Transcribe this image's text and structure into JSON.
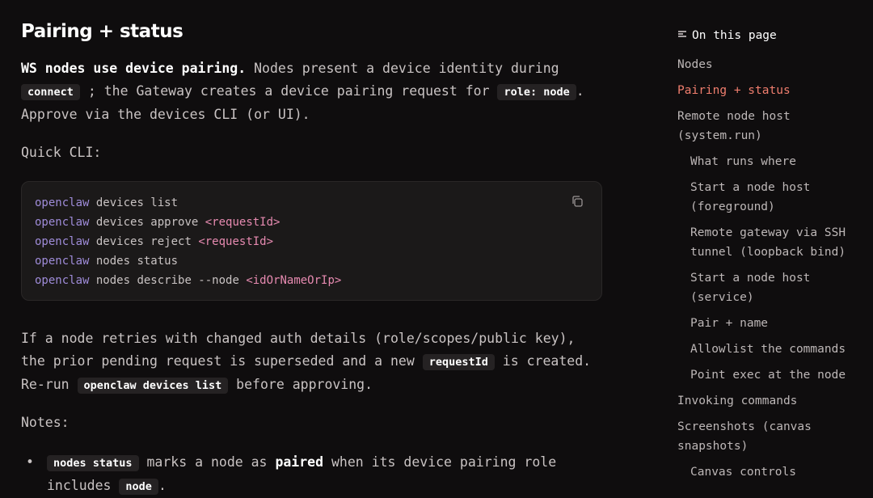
{
  "heading": "Pairing + status",
  "para1": {
    "bold": "WS nodes use device pairing.",
    "t1": " Nodes present a device identity during",
    "code1": "connect",
    "t2": "; the Gateway creates a device pairing request for",
    "code2": "role: node",
    "t3": ".",
    "t4": "Approve via the devices CLI (or UI)."
  },
  "quick_cli": "Quick CLI:",
  "code_block": {
    "lines": [
      {
        "cmd": "openclaw",
        "args": "devices list",
        "ph": ""
      },
      {
        "cmd": "openclaw",
        "args": "devices approve",
        "ph": "<requestId>"
      },
      {
        "cmd": "openclaw",
        "args": "devices reject",
        "ph": "<requestId>"
      },
      {
        "cmd": "openclaw",
        "args": "nodes status",
        "ph": ""
      },
      {
        "cmd": "openclaw",
        "args": "nodes describe --node",
        "ph": "<idOrNameOrIp>"
      }
    ],
    "copy_icon": "copy-icon"
  },
  "para2": {
    "l1": "If a node retries with changed auth details (role/scopes/public key),",
    "l2a": "the prior pending request is superseded and a new",
    "code1": "requestId",
    "l2b": "is created.",
    "l3a": "Re-run",
    "code2": "openclaw devices list",
    "l3b": "before approving."
  },
  "notes_label": "Notes:",
  "notes": {
    "item1": {
      "code": "nodes status",
      "t1": "marks a node as",
      "bold": "paired",
      "t2": "when its device pairing role",
      "t3": "includes",
      "code2": "node",
      "t4": "."
    }
  },
  "toc": {
    "title": "On this page",
    "icon": "list-icon",
    "items": [
      {
        "label": "Nodes"
      },
      {
        "label": "Pairing + status"
      },
      {
        "label": "Remote node host"
      },
      {
        "label": "(system.run)"
      },
      {
        "label": "What runs where"
      },
      {
        "label": "Start a node host"
      },
      {
        "label": "(foreground)"
      },
      {
        "label": "Remote gateway via SSH"
      },
      {
        "label": "tunnel (loopback bind)"
      },
      {
        "label": "Start a node host"
      },
      {
        "label": "(service)"
      },
      {
        "label": "Pair + name"
      },
      {
        "label": "Allowlist the commands"
      },
      {
        "label": "Point exec at the node"
      },
      {
        "label": "Invoking commands"
      },
      {
        "label": "Screenshots (canvas"
      },
      {
        "label": "snapshots)"
      },
      {
        "label": "Canvas controls"
      }
    ],
    "active_color": "#f07e6e"
  }
}
